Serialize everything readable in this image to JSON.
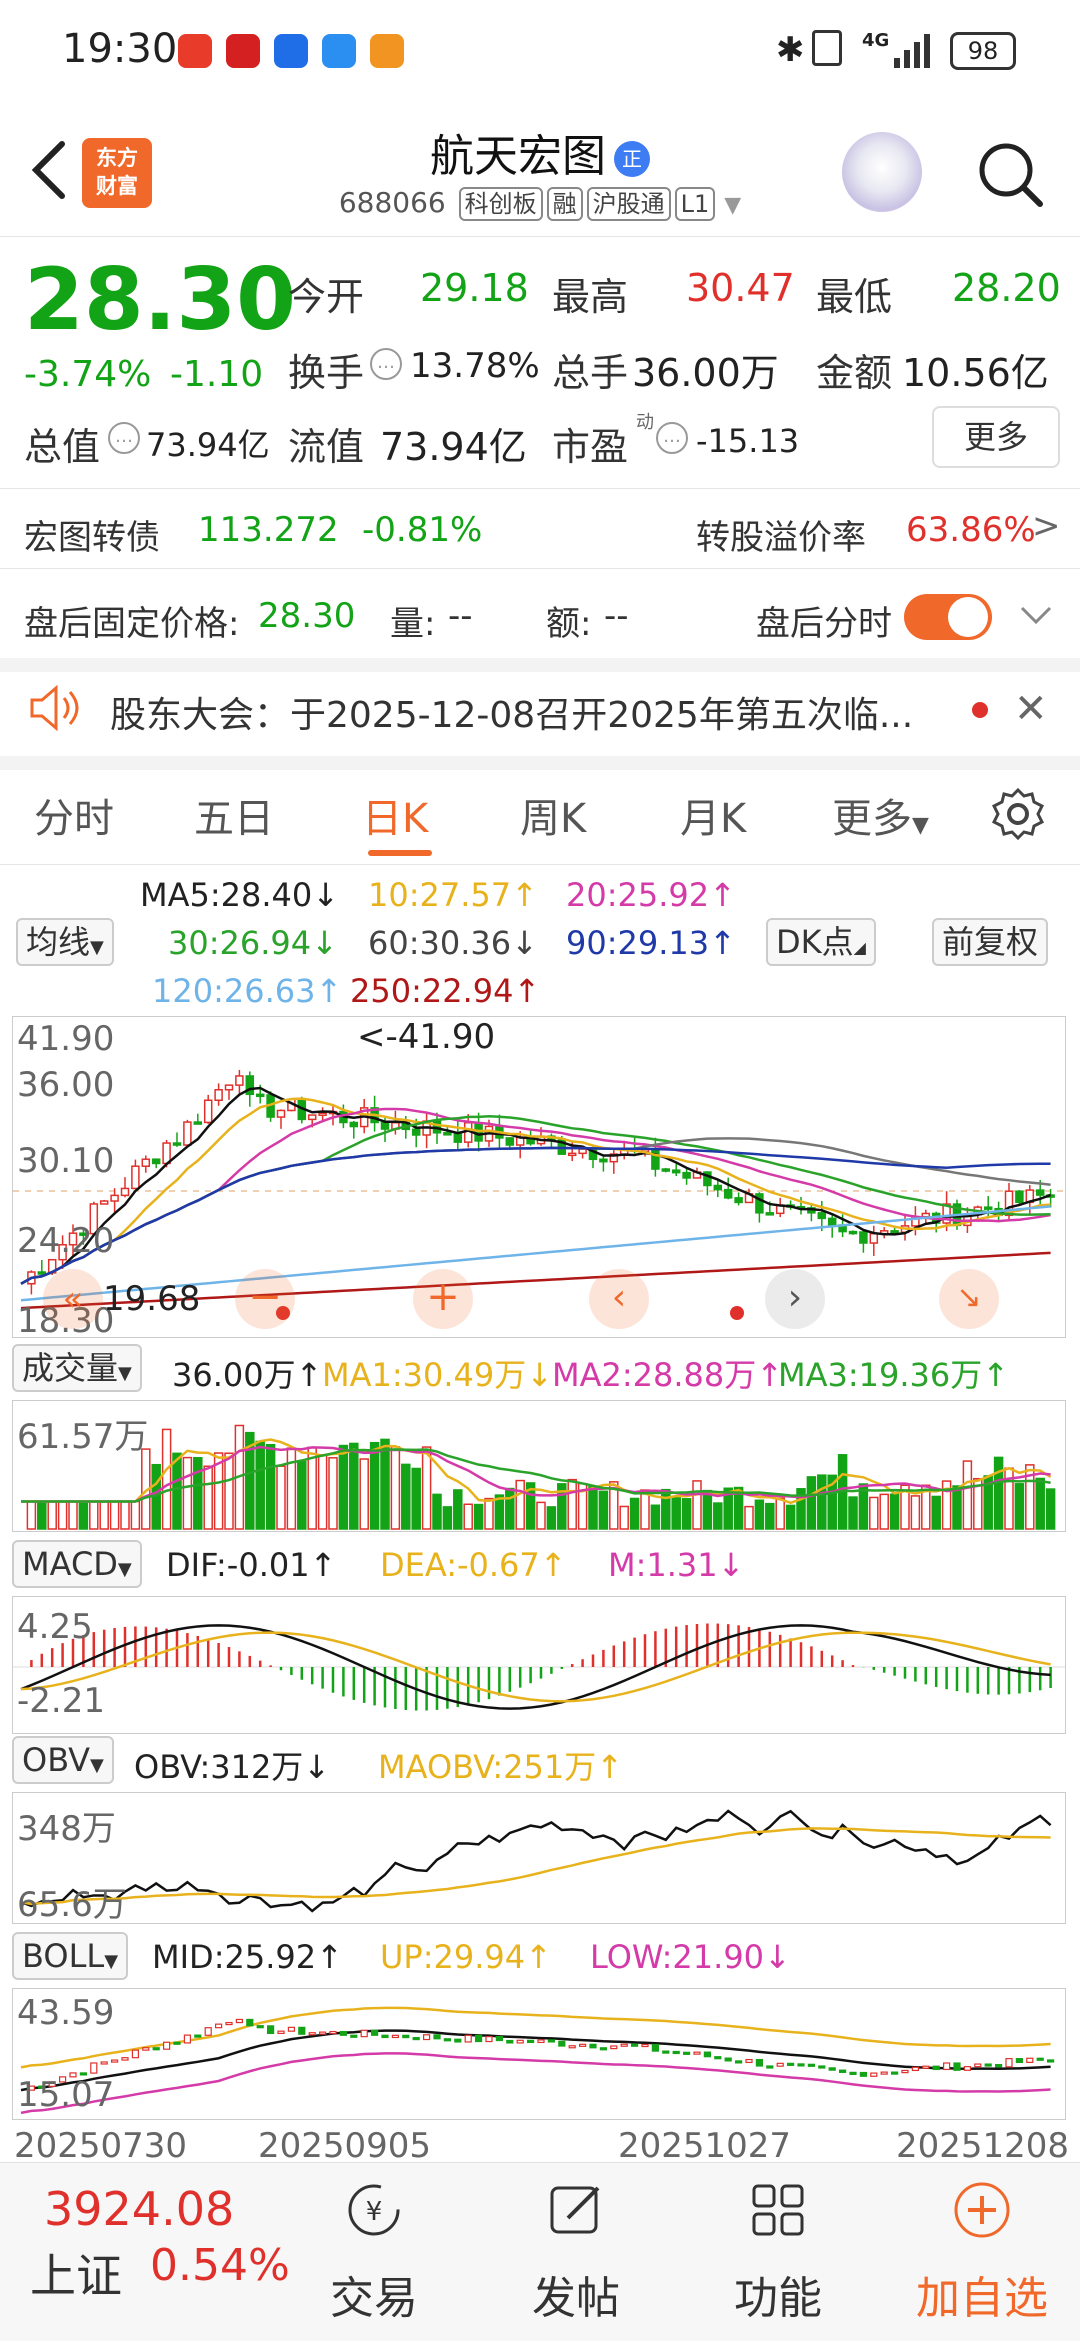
{
  "status_bar": {
    "time": "19:30",
    "network": "4G",
    "battery": "98",
    "app_icons": [
      "app-icon-1",
      "app-icon-2",
      "app-icon-3",
      "app-icon-4",
      "app-icon-5"
    ]
  },
  "header": {
    "logo_text": "东方财富",
    "title": "航天宏图",
    "title_badge": "正",
    "code": "688066",
    "tags": [
      "科创板",
      "融",
      "沪股通",
      "L1"
    ]
  },
  "quote": {
    "price": "28.30",
    "change_pct": "-3.74%",
    "change": "-1.10",
    "open_label": "今开",
    "open": "29.18",
    "high_label": "最高",
    "high": "30.47",
    "low_label": "最低",
    "low": "28.20",
    "turnover_label": "换手",
    "turnover": "13.78%",
    "volume_label": "总手",
    "volume": "36.00万",
    "amount_label": "金额",
    "amount": "10.56亿",
    "mktcap_label": "总值",
    "mktcap": "73.94亿",
    "float_label": "流值",
    "float_cap": "73.94亿",
    "pe_label": "市盈",
    "pe_sup": "动",
    "pe": "-15.13",
    "more_label": "更多"
  },
  "bond": {
    "name": "宏图转债",
    "price": "113.272",
    "change": "-0.81%",
    "premium_label": "转股溢价率",
    "premium": "63.86%"
  },
  "after_hours": {
    "label": "盘后固定价格:",
    "price": "28.30",
    "vol_label": "量:",
    "vol": "--",
    "amt_label": "额:",
    "amt": "--",
    "switch_label": "盘后分时"
  },
  "notice": {
    "text": "股东大会：于2025-12-08召开2025年第五次临..."
  },
  "tabs": [
    "分时",
    "五日",
    "日K",
    "周K",
    "月K",
    "更多"
  ],
  "active_tab": "日K",
  "ma": {
    "selector": "均线",
    "ma5": "MA5:28.40↓",
    "ma10": "10:27.57↑",
    "ma20": "20:25.92↑",
    "ma30": "30:26.94↓",
    "ma60": "60:30.36↓",
    "ma90": "90:29.13↑",
    "ma120": "120:26.63↑",
    "ma250": "250:22.94↑",
    "dk_label": "DK点",
    "adjust_label": "前复权"
  },
  "kline": {
    "y_labels": [
      "41.90",
      "36.00",
      "30.10",
      "24.20",
      "18.30"
    ],
    "high_marker": "<-41.90",
    "low_marker": "19.68"
  },
  "volume_panel": {
    "selector": "成交量",
    "value": "36.00万↑",
    "ma1": "MA1:30.49万↓",
    "ma2": "MA2:28.88万↑",
    "ma3": "MA3:19.36万↑",
    "y_label": "61.57万"
  },
  "macd_panel": {
    "selector": "MACD",
    "dif": "DIF:-0.01↑",
    "dea": "DEA:-0.67↑",
    "m": "M:1.31↓",
    "y_top": "4.25",
    "y_bottom": "-2.21"
  },
  "obv_panel": {
    "selector": "OBV",
    "obv": "OBV:312万↓",
    "maobv": "MAOBV:251万↑",
    "y_top": "348万",
    "y_bottom": "65.6万"
  },
  "boll_panel": {
    "selector": "BOLL",
    "mid": "MID:25.92↑",
    "up": "UP:29.94↑",
    "low": "LOW:21.90↓",
    "y_top": "43.59",
    "y_bottom": "15.07"
  },
  "x_dates": [
    "20250730",
    "20250905",
    "20251027",
    "20251208"
  ],
  "bottom_bar": {
    "index_value": "3924.08",
    "index_name": "上证",
    "index_change": "0.54%",
    "trade": "交易",
    "post": "发帖",
    "func": "功能",
    "add_watch": "加自选"
  },
  "colors": {
    "up": "#e0302b",
    "down": "#13a316",
    "accent": "#f0682a",
    "ma5": "#111111",
    "ma10": "#e8b21c",
    "ma20": "#d43aa8",
    "ma30": "#2aa32a",
    "ma60": "#777777",
    "ma90": "#1f3aa8",
    "ma120": "#6fb4e8",
    "ma250": "#b01818"
  }
}
